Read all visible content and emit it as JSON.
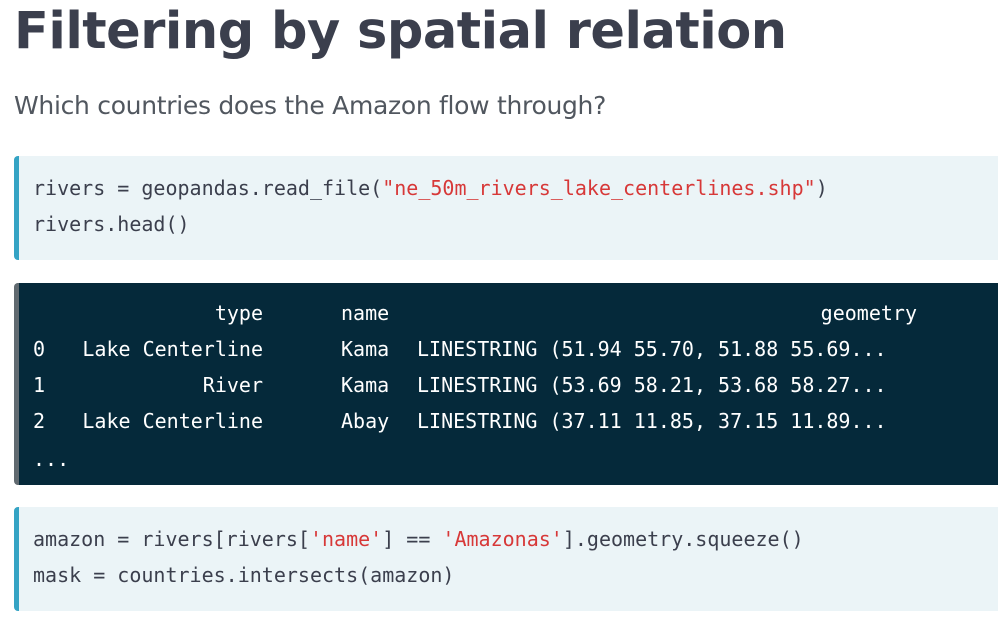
{
  "title": "Filtering by spatial relation",
  "subtitle": "Which countries does the Amazon flow through?",
  "code_top": {
    "line1": {
      "pre": "rivers = geopandas.read_file(",
      "str": "\"ne_50m_rivers_lake_centerlines.shp\"",
      "post": ")"
    },
    "line2": "rivers.head()"
  },
  "output": {
    "headers": [
      "type",
      "name",
      "geometry"
    ],
    "rows": [
      {
        "index": "0",
        "type": "Lake Centerline",
        "name": "Kama",
        "geometry": "LINESTRING (51.94 55.70, 51.88 55.69..."
      },
      {
        "index": "1",
        "type": "River",
        "name": "Kama",
        "geometry": "LINESTRING (53.69 58.21, 53.68 58.27..."
      },
      {
        "index": "2",
        "type": "Lake Centerline",
        "name": "Abay",
        "geometry": "LINESTRING (37.11 11.85, 37.15 11.89..."
      }
    ],
    "ellipsis": "..."
  },
  "code_bottom": {
    "line1": {
      "p1": "amazon = rivers[rivers[",
      "s1": "'name'",
      "p2": "] == ",
      "s2": "'Amazonas'",
      "p3": "].geometry.squeeze()"
    },
    "line2": "mask = countries.intersects(amazon)"
  },
  "colors": {
    "code_background": "#ebf4f7",
    "code_accent": "#34a3c4",
    "output_background": "#05293a",
    "string_color": "#d73838",
    "title_color": "#3b3f4d"
  }
}
